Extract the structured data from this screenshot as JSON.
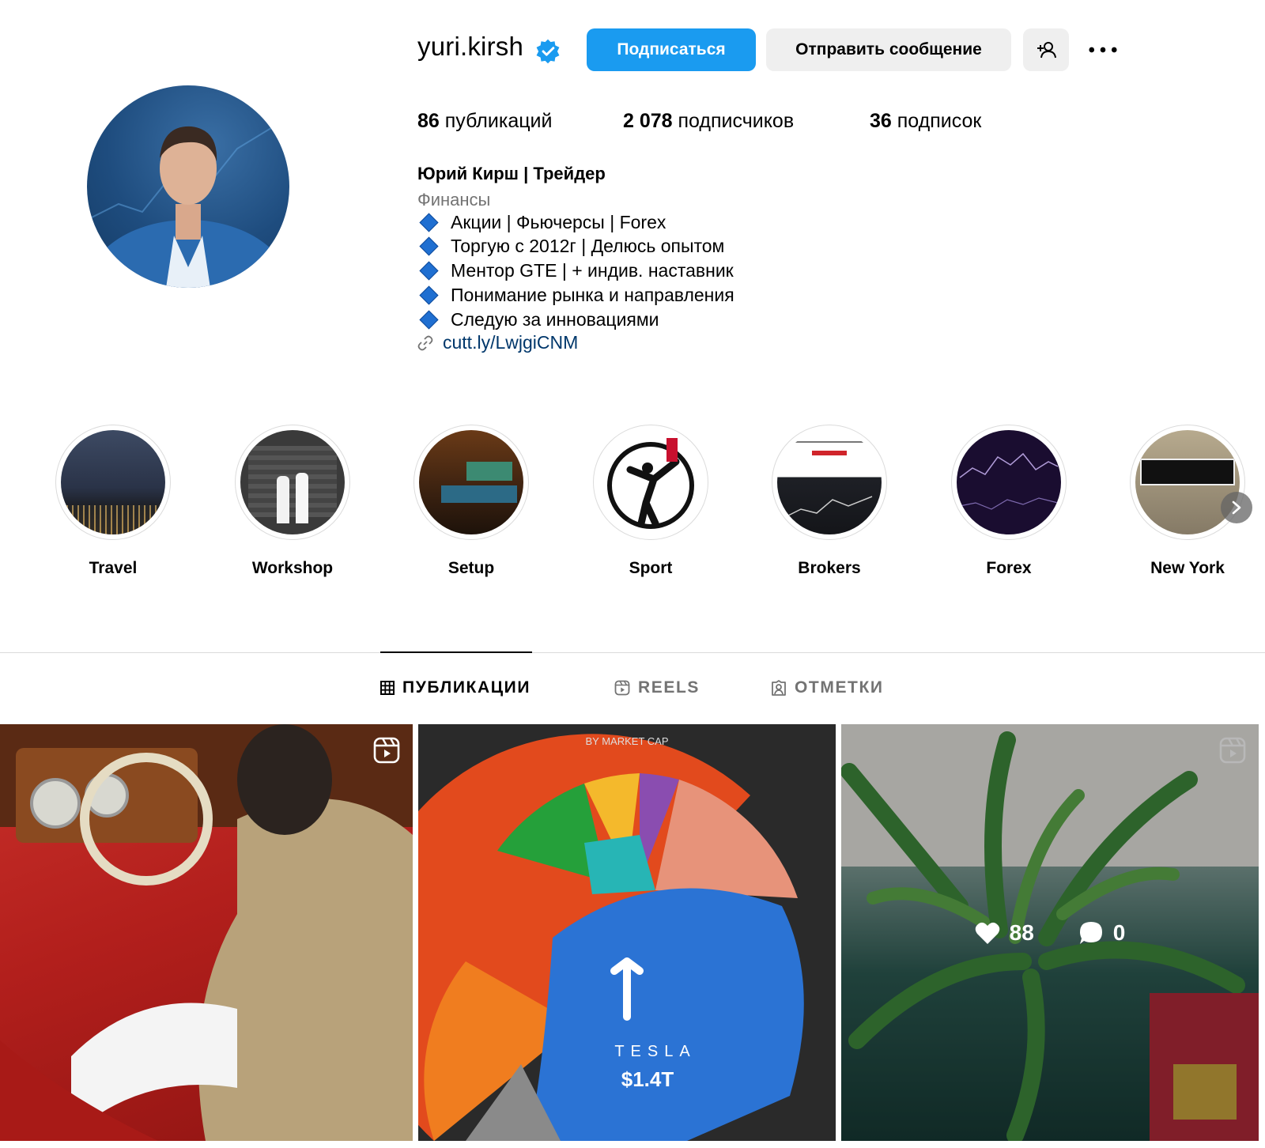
{
  "profile": {
    "username": "yuri.kirsh",
    "verified": true,
    "follow_label": "Подписаться",
    "message_label": "Отправить сообщение",
    "stats": {
      "posts_count": "86",
      "posts_label": "публикаций",
      "followers_count": "2 078",
      "followers_label": "подписчиков",
      "following_count": "36",
      "following_label": "подписок"
    },
    "full_name": "Юрий Кирш | Трейдер",
    "category": "Финансы",
    "bio": [
      "Акции | Фьючерсы | Forex",
      "Торгую с 2012г | Делюсь опытом",
      "Ментор GTE | + индив. наставник",
      "Понимание рынка и направления",
      "Следую за инновациями"
    ],
    "link": "cutt.ly/LwjgiCNM"
  },
  "highlights": [
    {
      "label": "Travel"
    },
    {
      "label": "Workshop"
    },
    {
      "label": "Setup"
    },
    {
      "label": "Sport"
    },
    {
      "label": "Brokers"
    },
    {
      "label": "Forex"
    },
    {
      "label": "New York"
    }
  ],
  "tabs": [
    {
      "label": "ПУБЛИКАЦИИ",
      "active": true
    },
    {
      "label": "REELS",
      "active": false
    },
    {
      "label": "ОТМЕТКИ",
      "active": false
    }
  ],
  "posts": [
    {
      "type": "reel"
    },
    {
      "type": "image",
      "caption": "BY MARKET CAP",
      "brand": "TESLA",
      "value": "$1.4T"
    },
    {
      "type": "reel",
      "likes": "88",
      "comments": "0"
    }
  ],
  "colors": {
    "accent": "#1a9bf0",
    "link": "#00376b",
    "muted": "#737373",
    "bio_diamond": "#1f6fd1"
  },
  "icons": [
    "verified-badge-icon",
    "add-user-icon",
    "more-icon",
    "link-icon",
    "grid-icon",
    "reels-icon",
    "tagged-icon",
    "reel-icon",
    "heart-icon",
    "comment-icon",
    "chevron-right-icon"
  ]
}
